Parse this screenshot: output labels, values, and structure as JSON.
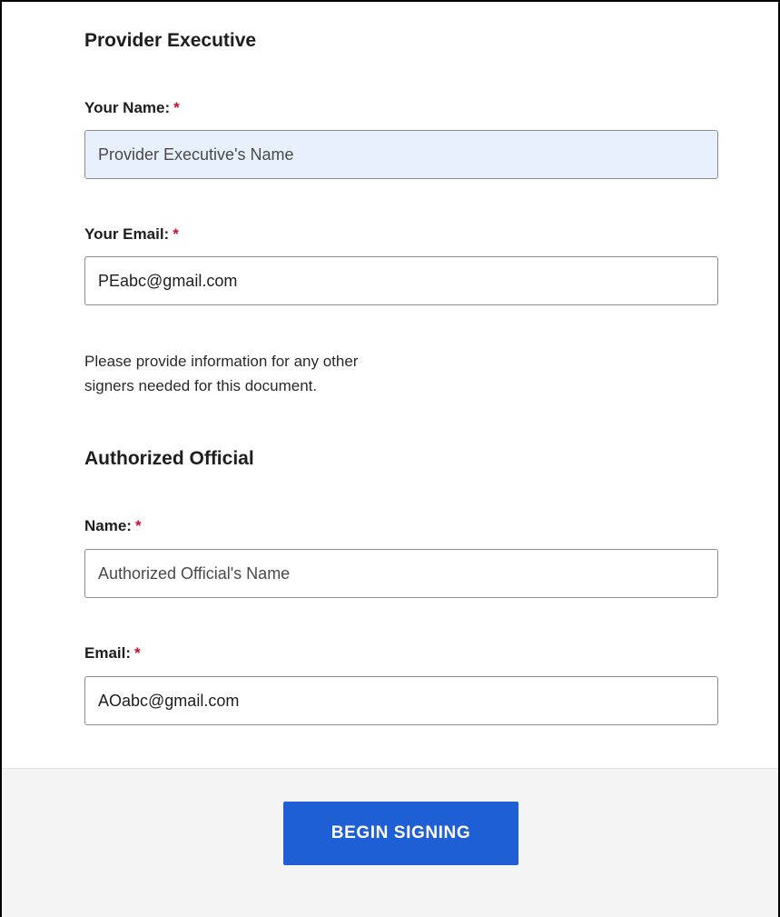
{
  "provider_section": {
    "title": "Provider Executive",
    "name_label": "Your Name:",
    "name_required": "*",
    "name_placeholder": "Provider Executive's Name",
    "email_label": "Your Email:",
    "email_required": "*",
    "email_value": "PEabc@gmail.com"
  },
  "info": {
    "line1": "Please provide information for any other",
    "line2": "signers needed for this document."
  },
  "official_section": {
    "title": "Authorized Official",
    "name_label": "Name:",
    "name_required": "*",
    "name_placeholder": "Authorized Official's Name",
    "email_label": "Email:",
    "email_required": "*",
    "email_value": "AOabc@gmail.com"
  },
  "footer": {
    "begin_label": "BEGIN SIGNING"
  },
  "colors": {
    "accent": "#1f5fd6",
    "required": "#c8102e",
    "autofill_bg": "#e8f0fe",
    "footer_bg": "#f4f4f4"
  }
}
